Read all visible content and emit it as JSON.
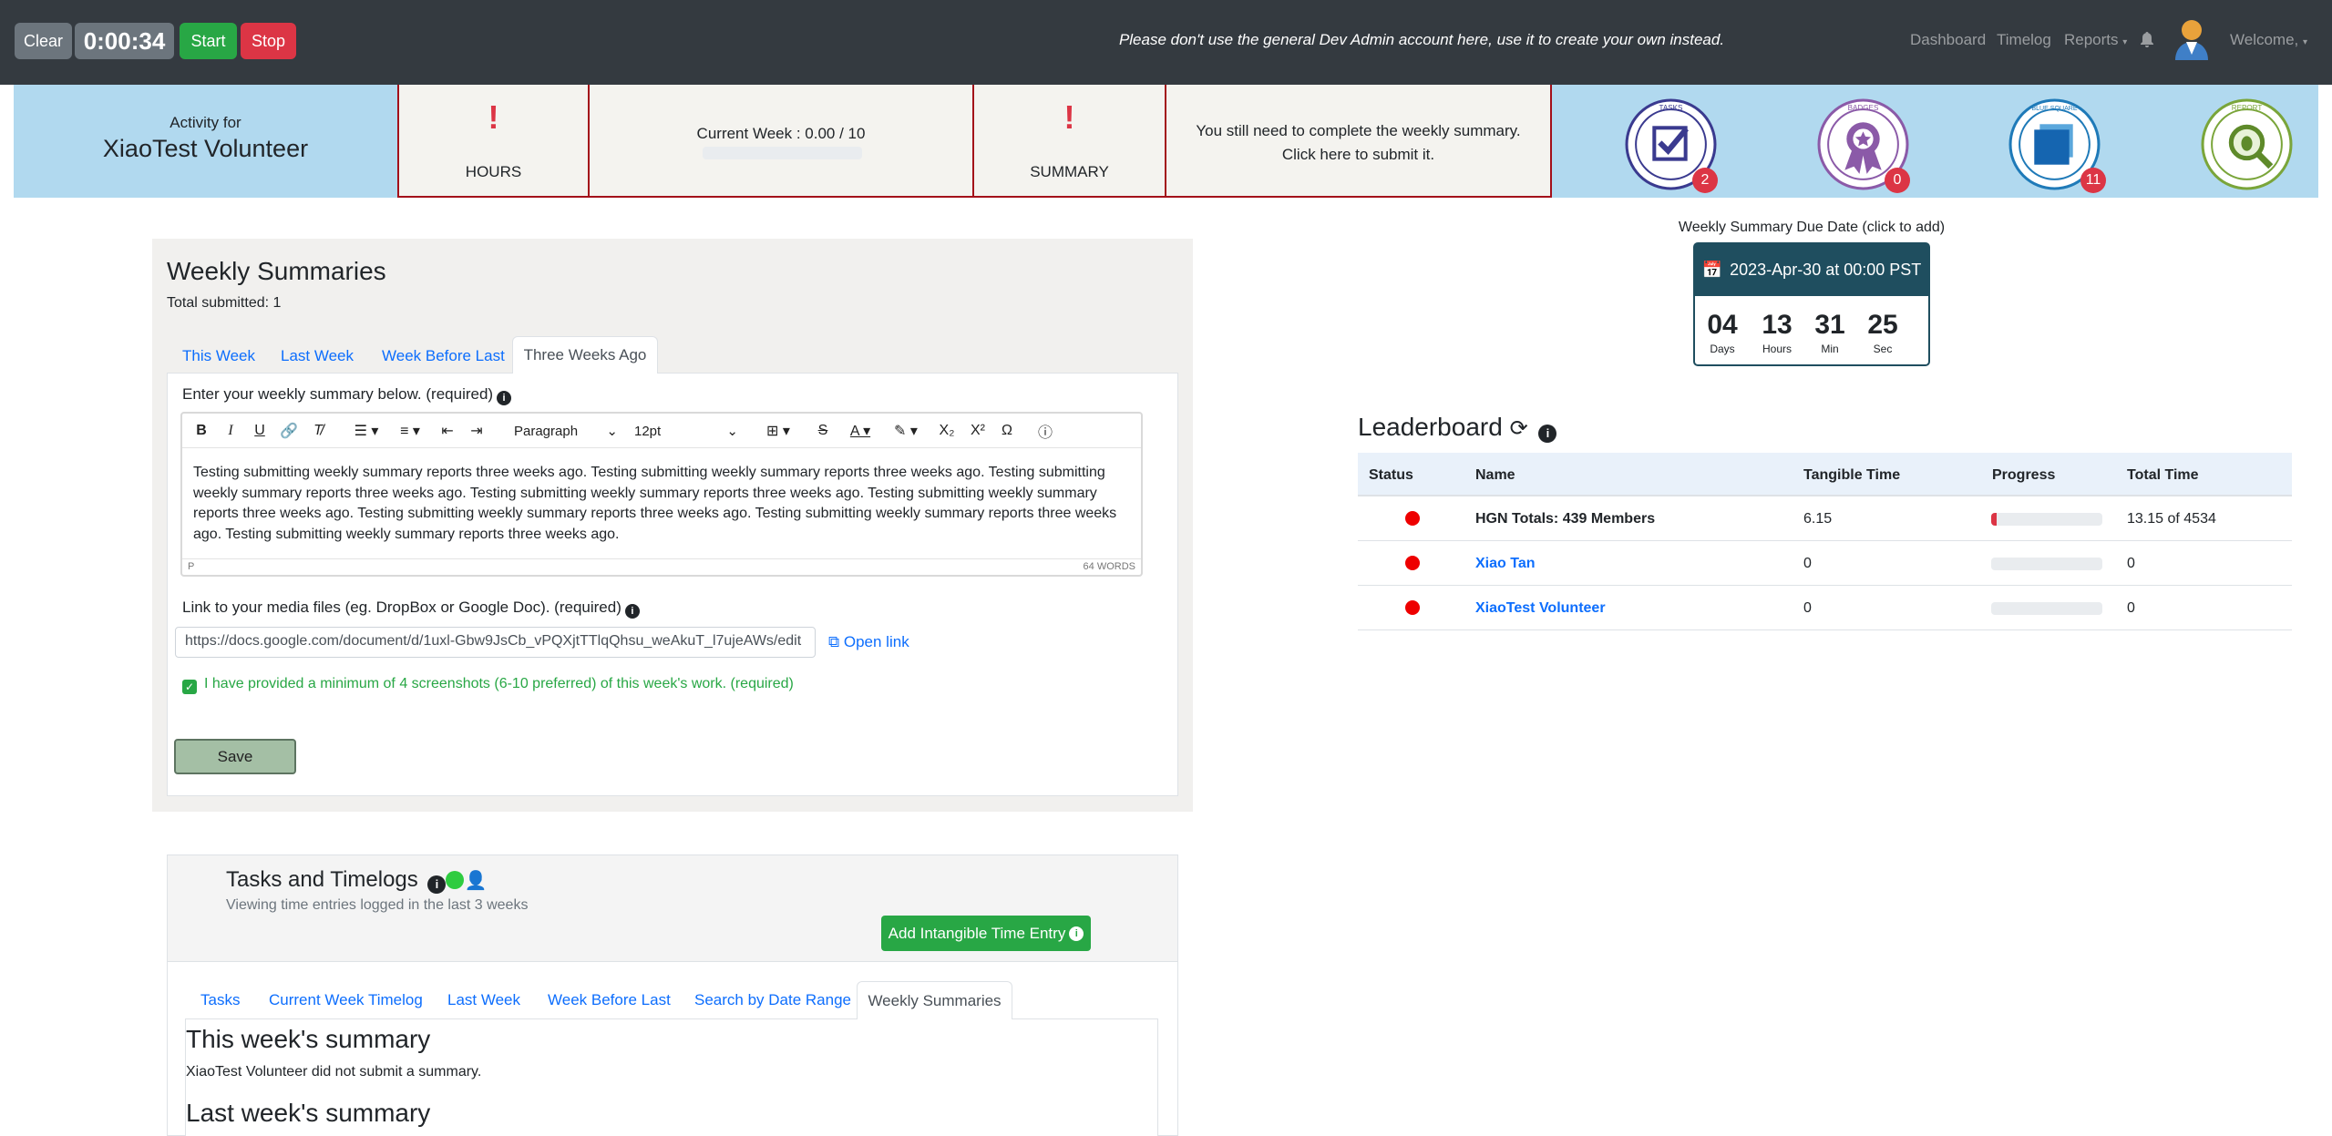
{
  "navbar": {
    "clear": "Clear",
    "timer": "0:00:34",
    "start": "Start",
    "stop": "Stop",
    "notice": "Please don't use the general Dev Admin account here, use it to create your own instead.",
    "dashboard": "Dashboard",
    "timelog": "Timelog",
    "reports": "Reports",
    "welcome": "Welcome,"
  },
  "activity": {
    "caption": "Activity for",
    "name": "XiaoTest Volunteer",
    "hours_label": "HOURS",
    "week_text": "Current Week : 0.00 / 10",
    "week_progress": 0,
    "summary_label": "SUMMARY",
    "summary_msg": "You still need to complete the weekly summary. Click here to submit it.",
    "badges": [
      {
        "name": "tasks-badge",
        "top": "TASKS",
        "bottom": "WHY CRITERIA UPDATE",
        "count": "2",
        "color": "#1e3a8a"
      },
      {
        "name": "badges-earned",
        "top": "BADGES",
        "bottom": "EARNED",
        "count": "0",
        "color": "#8b4bb8"
      },
      {
        "name": "blue-square-record",
        "top": "BLUE SQUARE",
        "bottom": "RECORD",
        "count": "11",
        "color": "#1f7ab8"
      },
      {
        "name": "report-app-bug",
        "top": "REPORT",
        "bottom": "APP BUG",
        "count": "",
        "color": "#6ea033"
      }
    ]
  },
  "weekly": {
    "title": "Weekly Summaries",
    "total": "Total submitted: 1",
    "tabs": [
      "This Week",
      "Last Week",
      "Week Before Last",
      "Three Weeks Ago"
    ],
    "active_tab": "Three Weeks Ago",
    "prompt": "Enter your weekly summary below. (required)",
    "toolbar": {
      "paragraph": "Paragraph",
      "size": "12pt"
    },
    "body": "Testing submitting weekly summary reports three weeks ago. Testing submitting weekly summary reports three weeks ago. Testing submitting weekly summary reports three weeks ago. Testing submitting weekly summary reports three weeks ago. Testing submitting weekly summary reports three weeks ago. Testing submitting weekly summary reports three weeks ago. Testing submitting weekly summary reports three weeks ago. Testing submitting weekly summary reports three weeks ago.",
    "status_tag": "P",
    "word_count": "64 WORDS",
    "link_label": "Link to your media files (eg. DropBox or Google Doc). (required)",
    "link_value": "https://docs.google.com/document/d/1uxl-Gbw9JsCb_vPQXjtTTlqQhsu_weAkuT_l7ujeAWs/edit",
    "open_link": "Open link",
    "checkbox": "I have provided a minimum of 4 screenshots (6-10 preferred) of this week's work. (required)",
    "save": "Save"
  },
  "due": {
    "caption": "Weekly Summary Due Date (click to add)",
    "date": "2023-Apr-30 at 00:00 PST",
    "days": "04",
    "hours": "13",
    "min": "31",
    "sec": "25",
    "days_label": "Days",
    "hours_label": "Hours",
    "min_label": "Min",
    "sec_label": "Sec"
  },
  "leaderboard": {
    "title": "Leaderboard",
    "headers": [
      "Status",
      "Name",
      "Tangible Time",
      "Progress",
      "Total Time"
    ],
    "rows": [
      {
        "name": "HGN Totals: 439 Members",
        "tangible": "6.15",
        "progress": 0.05,
        "total": "13.15 of 4534"
      },
      {
        "name": "Xiao Tan",
        "tangible": "0",
        "progress": 0,
        "total": "0"
      },
      {
        "name": "XiaoTest Volunteer",
        "tangible": "0",
        "progress": 0,
        "total": "0"
      }
    ]
  },
  "tasks": {
    "title": "Tasks and Timelogs",
    "subtitle": "Viewing time entries logged in the last 3 weeks",
    "add_button": "Add Intangible Time Entry",
    "tabs": [
      "Tasks",
      "Current Week Timelog",
      "Last Week",
      "Week Before Last",
      "Search by Date Range",
      "Weekly Summaries"
    ],
    "active_tab": "Weekly Summaries",
    "this_week_heading": "This week's summary",
    "this_week_text": "XiaoTest Volunteer did not submit a summary.",
    "last_week_heading": "Last week's summary"
  }
}
